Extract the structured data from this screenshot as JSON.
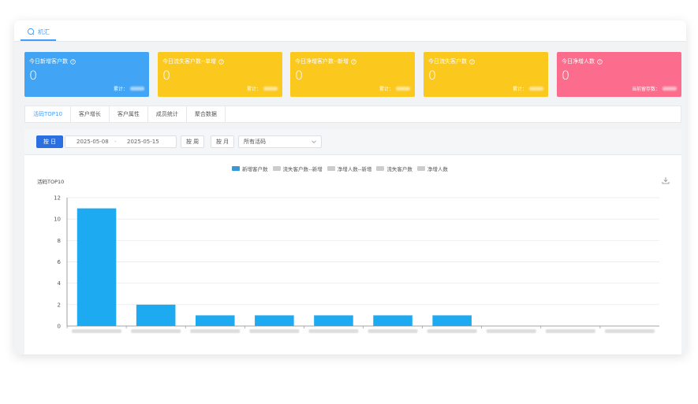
{
  "app_tab": {
    "label": "机汇"
  },
  "cards": [
    {
      "title": "今日新增客户数",
      "value": "0",
      "footer_label": "累计：",
      "color": "#41a4f5"
    },
    {
      "title": "今日流失客户数--单增",
      "value": "0",
      "footer_label": "累计：",
      "color": "#fbc81e"
    },
    {
      "title": "今日净增客户数--新增",
      "value": "0",
      "footer_label": "累计：",
      "color": "#fbc81e"
    },
    {
      "title": "今日流失客户数",
      "value": "0",
      "footer_label": "累计：",
      "color": "#fbc81e"
    },
    {
      "title": "今日净增人数",
      "value": "0",
      "footer_label": "当前留存数：",
      "color": "#fc6c8c"
    }
  ],
  "tabs": [
    "活码TOP10",
    "客户增长",
    "客户属性",
    "成员统计",
    "聚合数据"
  ],
  "active_tab": 0,
  "filters": {
    "day_button": "按 日",
    "date_start": "2025-05-08",
    "date_sep": "-",
    "date_end": "2025-05-15",
    "week_button": "按 周",
    "month_button": "按 月",
    "select_value": "所有活码"
  },
  "chart_data": {
    "type": "bar",
    "title": "活码TOP10",
    "legend": [
      {
        "name": "新增客户数",
        "color": "#3a97d6"
      },
      {
        "name": "流失客户数--新增",
        "color": "#cccccc"
      },
      {
        "name": "净增人数--新增",
        "color": "#cccccc"
      },
      {
        "name": "流失客户数",
        "color": "#cccccc"
      },
      {
        "name": "净增人数",
        "color": "#cccccc"
      }
    ],
    "categories": [
      "",
      "",
      "",
      "",
      "",
      "",
      "",
      "",
      "",
      ""
    ],
    "series": [
      {
        "name": "新增客户数",
        "values": [
          11,
          2,
          1,
          1,
          1,
          1,
          1,
          0,
          0,
          0
        ],
        "color": "#1eaaf1"
      }
    ],
    "ylim": [
      0,
      12
    ],
    "yticks": [
      0,
      2,
      4,
      6,
      8,
      10,
      12
    ],
    "grid": true,
    "legend_position": "top-center"
  }
}
